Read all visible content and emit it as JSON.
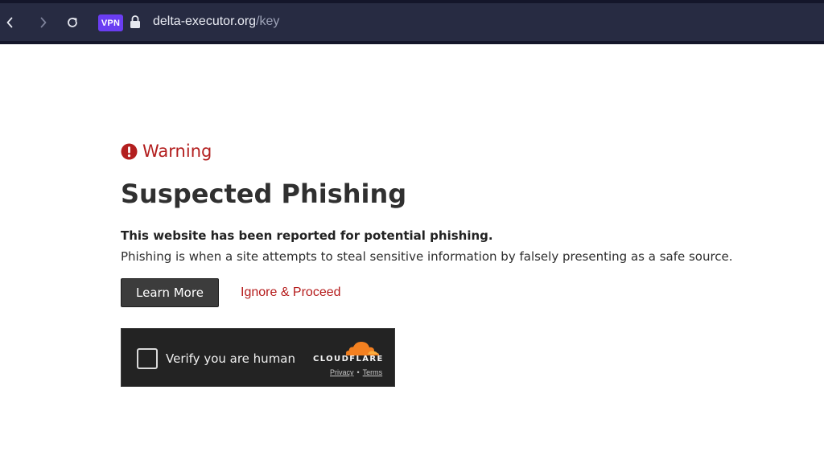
{
  "browser": {
    "vpn_label": "VPN",
    "url_host": "delta-executor.org",
    "url_path": "/key",
    "colors": {
      "bar": "#272b42",
      "vpn": "#6a3df2"
    }
  },
  "warning": {
    "label": "Warning",
    "icon": "exclamation-circle-icon",
    "color": "#b31f1f"
  },
  "page": {
    "title": "Suspected Phishing",
    "lead": "This website has been reported for potential phishing.",
    "description": "Phishing is when a site attempts to steal sensitive information by falsely presenting as a safe source."
  },
  "actions": {
    "learn_more": "Learn More",
    "ignore_proceed": "Ignore & Proceed"
  },
  "turnstile": {
    "label": "Verify you are human",
    "brand": "CLOUDFLARE",
    "privacy": "Privacy",
    "separator": "•",
    "terms": "Terms",
    "checked": false
  }
}
